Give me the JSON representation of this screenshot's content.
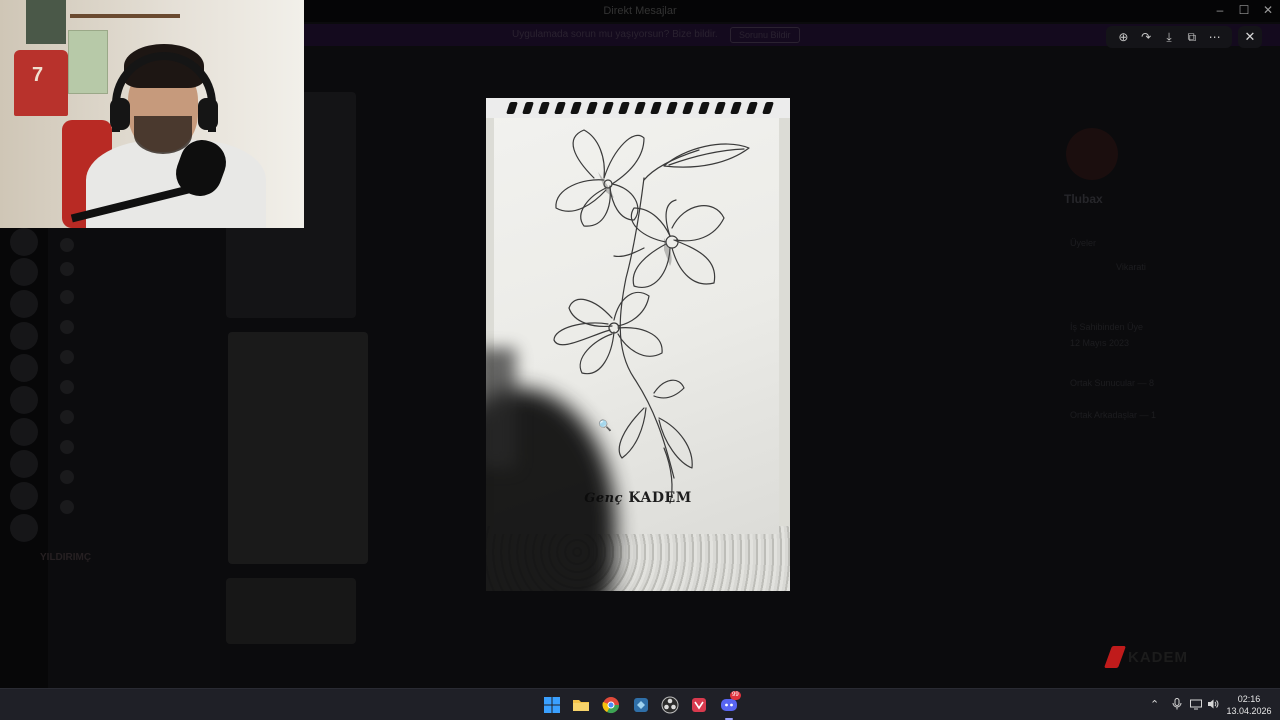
{
  "window": {
    "title": "Direkt Mesajlar"
  },
  "banner": {
    "text": "Uygulamada sorun mu yaşıyorsun? Bize bildir.",
    "button_label": "Sorunu Bildir"
  },
  "viewer": {
    "toolbar": [
      {
        "name": "zoom-in-icon",
        "glyph": "⊕"
      },
      {
        "name": "forward-icon",
        "glyph": "↷"
      },
      {
        "name": "download-icon",
        "glyph": "⤓"
      },
      {
        "name": "open-external-icon",
        "glyph": "⧉"
      },
      {
        "name": "more-options-icon",
        "glyph": "⋯"
      }
    ],
    "close_glyph": "✕",
    "image_caption_script": "Genç",
    "image_caption_main": "KADEM",
    "cursor_glyph": "🔍"
  },
  "webcam": {
    "jersey_number": "7"
  },
  "watermark": {
    "name": "KADEM"
  },
  "sidebar": {
    "voice_section": "YILDIRIMÇ"
  },
  "right_panel": {
    "name": "Tlubax",
    "lines": [
      "Üyeler",
      "Vikarati",
      "İş Sahibinden Üye",
      "12 Mayıs 2023",
      "Ortak Sunucular — 8",
      "Ortak Arkadaşlar — 1"
    ]
  },
  "taskbar": {
    "apps": [
      {
        "name": "windows-start-icon",
        "color": "#3aa0ff"
      },
      {
        "name": "file-explorer-icon",
        "color": "#f2c24a"
      },
      {
        "name": "chrome-icon",
        "color": "#e04a3a"
      },
      {
        "name": "app-icon",
        "color": "#5aa6d8"
      },
      {
        "name": "obs-icon",
        "color": "#bbbbbb"
      },
      {
        "name": "app-red-icon",
        "color": "#d83a4e"
      },
      {
        "name": "discord-icon",
        "color": "#5865f2"
      }
    ],
    "discord_badge": "99",
    "clock_time": "02:16",
    "clock_date": "13.04.2026"
  }
}
